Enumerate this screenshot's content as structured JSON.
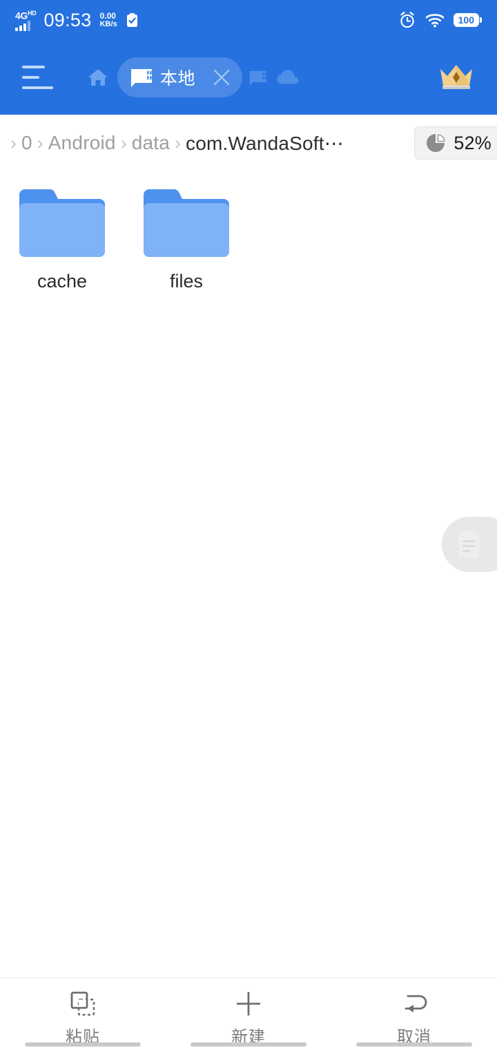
{
  "status_bar": {
    "network_type": "4G",
    "network_suffix": "HD",
    "time": "09:53",
    "speed_value": "0.00",
    "speed_unit": "KB/s",
    "checkbox_icon": "checked-clipboard-icon",
    "alarm_icon": "alarm-clock-icon",
    "wifi_icon": "wifi-icon",
    "battery_level": "100"
  },
  "header": {
    "menu_icon": "hamburger-menu-icon",
    "home_icon": "home-icon",
    "active_tab": {
      "icon": "sd-card-icon",
      "label": "本地",
      "close_icon": "close-x-icon"
    },
    "inactive_icons": [
      {
        "name": "sd-card-icon",
        "label": "SD"
      },
      {
        "name": "cloud-icon",
        "label": "Cloud"
      }
    ],
    "vip_icon": "crown-icon",
    "background_color": "#2671E0"
  },
  "breadcrumb": {
    "separator": "›",
    "items": [
      {
        "label": "0",
        "current": false
      },
      {
        "label": "Android",
        "current": false
      },
      {
        "label": "data",
        "current": false
      },
      {
        "label": "com.WandaSoft⋯",
        "current": true
      }
    ],
    "storage": {
      "icon": "pie-chart-icon",
      "percent": "52%"
    }
  },
  "files": {
    "items": [
      {
        "name": "cache",
        "type": "folder",
        "icon": "folder-icon"
      },
      {
        "name": "files",
        "type": "folder",
        "icon": "folder-icon"
      }
    ],
    "folder_color": "#7FB2F7",
    "folder_tab_color": "#4E92F0"
  },
  "floating_button": {
    "icon": "clipboard-icon",
    "name": "clipboard-fab"
  },
  "bottom_bar": {
    "actions": [
      {
        "icon": "paste-icon",
        "label": "粘贴"
      },
      {
        "icon": "plus-icon",
        "label": "新建"
      },
      {
        "icon": "undo-arrow-icon",
        "label": "取消"
      }
    ]
  }
}
